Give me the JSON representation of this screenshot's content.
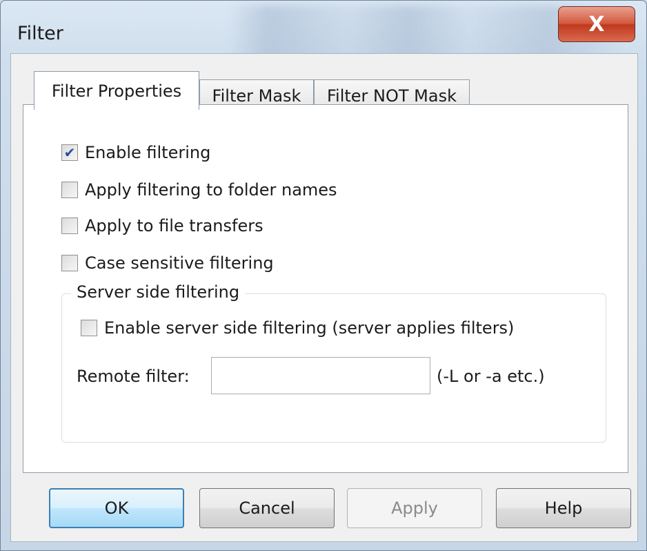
{
  "window": {
    "title": "Filter",
    "close_glyph": "X"
  },
  "tabs": [
    {
      "label": "Filter Properties",
      "active": true
    },
    {
      "label": "Filter Mask",
      "active": false
    },
    {
      "label": "Filter NOT Mask",
      "active": false
    }
  ],
  "options": {
    "enable_filtering": {
      "label": "Enable filtering",
      "checked": true
    },
    "apply_folder_names": {
      "label": "Apply filtering to folder names",
      "checked": false
    },
    "apply_file_transfers": {
      "label": "Apply to file transfers",
      "checked": false
    },
    "case_sensitive": {
      "label": "Case sensitive filtering",
      "checked": false
    }
  },
  "server_side": {
    "group_title": "Server side filtering",
    "enable": {
      "label": "Enable server side filtering (server applies filters)",
      "checked": false
    },
    "remote_filter_label": "Remote filter:",
    "remote_filter_value": "",
    "remote_filter_hint": "(-L or -a etc.)"
  },
  "buttons": {
    "ok": "OK",
    "cancel": "Cancel",
    "apply": "Apply",
    "help": "Help"
  },
  "icons": {
    "checkmark": "check-icon",
    "close": "close-icon"
  }
}
